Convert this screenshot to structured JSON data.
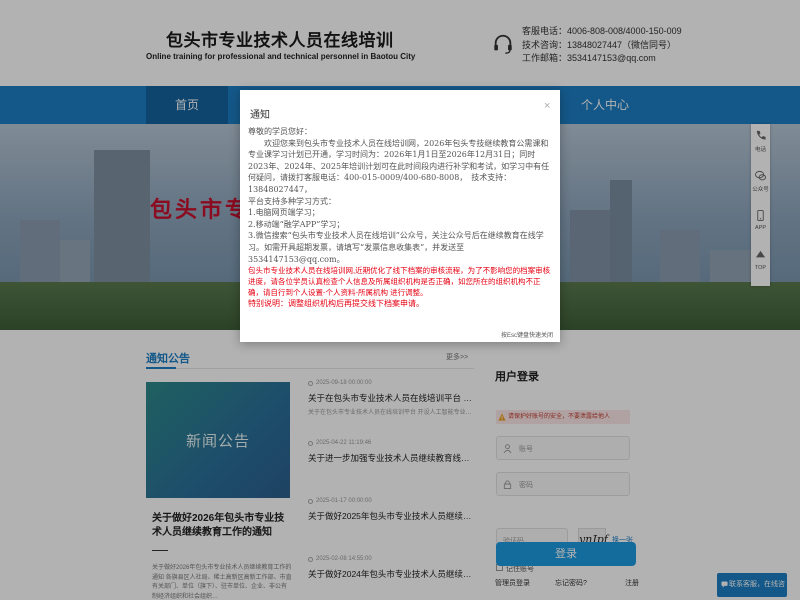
{
  "header": {
    "title": "包头市专业技术人员在线培训",
    "subtitle": "Online training for professional and technical personnel in Baotou City",
    "contact": [
      "客服电话：4006-808-008/4000-150-009",
      "技术咨询：13848027447（微信同号）",
      "工作邮箱：3534147153@qq.com"
    ]
  },
  "nav": {
    "home": "首页",
    "personal": "个人中心"
  },
  "banner": {
    "text": "包头市专"
  },
  "news": {
    "heading": "通知公告",
    "more": "更多>>",
    "banner_text": "新闻公告",
    "feature_title": "关于做好2026年包头市专业技术人员继续教育工作的通知",
    "feature_desc": "关于做好2026年包头市专业技术人员继续教育工作的通知 各旗县区人社局、稀土高新区高新工作部、市直有关部门、单位（旗下）、驻市单位、企业、非公有制经济组织和社会组织…",
    "items": [
      {
        "date": "2025-09-18 00:00:00",
        "title": "关于在包头市专业技术人员在线培训平台 开设人工智能…",
        "sub": "关于在包头市专业技术人员在线培训平台 开设人工智能专业课程的通知"
      },
      {
        "date": "2025-04-22 11:19:46",
        "title": "关于进一步加强专业技术人员继续教育线下档案审核…",
        "sub": ""
      },
      {
        "date": "2025-01-17 00:00:00",
        "title": "关于做好2025年包头市专业技术人员继续教育工作的…",
        "sub": ""
      },
      {
        "date": "2025-02-08 14:55:00",
        "title": "关于做好2024年包头市专业技术人员继续教育工作的…",
        "sub": ""
      }
    ]
  },
  "login": {
    "title": "用户登录",
    "warning": "请保护好账号的安全，不要泄露给他人",
    "username_placeholder": "账号",
    "password_placeholder": "密码",
    "captcha_placeholder": "验证码",
    "captcha_text": "ynJpf",
    "refresh": "换一张",
    "remember": "记住账号",
    "button": "登录",
    "admin_login": "管理员登录",
    "forgot": "忘记密码?",
    "register": "注册"
  },
  "float_bar": {
    "items": [
      "电话",
      "公众号",
      "APP",
      "TOP"
    ]
  },
  "chat": {
    "label": "联系客服，在线咨询"
  },
  "modal": {
    "title": "通知",
    "close": "×",
    "greeting": "尊敬的学员您好：",
    "paragraph1": "欢迎您来到包头市专业技术人员在线培训网，2026年包头专技继续教育公需课和专业课学习计划已开通，学习时间为：2026年1月1日至2026年12月31日；同时2023年、2024年、2025年培训计划可在此时间段内进行补学和考试，如学习中有任何疑问，请拨打客服电话：400-015-0009/400-680-8008，　技术支持：13848027447，",
    "paragraph2": "平台支持多种学习方式：",
    "line1": "1.电脑网页端学习；",
    "line2": "2.移动端“融学APP”学习；",
    "line3": "3.微信搜索“包头市专业技术人员在线培训”公众号，关注公众号后在继续教育在线学习。如需开具超期发票，请填写“发票信息收集表”，并发送至3534147153@qq.com。",
    "red": "包头市专业技术人员在线培训网,近期优化了线下档案的审核流程，为了不影响您的档案审核进度，请各位学员认真检查个人信息及所属组织机构是否正确，如您所在的组织机构不正确，请自行到个人设置-个人资料-所属机构  进行调整。",
    "red2": "特别说明：调整组织机构后再提交线下档案申请。",
    "footer": "按Esc键盘快速关闭"
  },
  "colors": {
    "primary": "#1d7fc4",
    "nav_active": "#13649f",
    "alert": "#e60012"
  }
}
